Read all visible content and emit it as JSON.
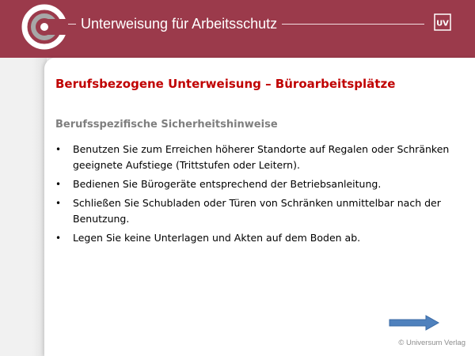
{
  "header": {
    "title": "Unterweisung für Arbeitsschutz",
    "badge_text": "UV",
    "logo_icon": "circle-logo-icon",
    "band_color": "#9b3a4b"
  },
  "slide": {
    "title": "Berufsbezogene Unterweisung – Büroarbeitsplätze",
    "title_color": "#c00000",
    "subtitle": "Berufsspezifische Sicherheitshinweise",
    "bullets": [
      "Benutzen Sie zum Erreichen höherer Standorte auf Regalen oder Schränken geeignete Aufstiege (Trittstufen oder Leitern).",
      "Bedienen Sie Bürogeräte entsprechend der Betriebsanleitung.",
      "Schließen Sie Schubladen oder Türen von Schränken unmittelbar nach der Benutzung.",
      "Legen Sie keine Unterlagen und Akten auf dem Boden ab."
    ],
    "bullet_symbol": "•"
  },
  "navigation": {
    "next_icon": "arrow-right-icon",
    "arrow_color": "#4f81bd"
  },
  "footer": {
    "copyright": "© Universum Verlag"
  }
}
